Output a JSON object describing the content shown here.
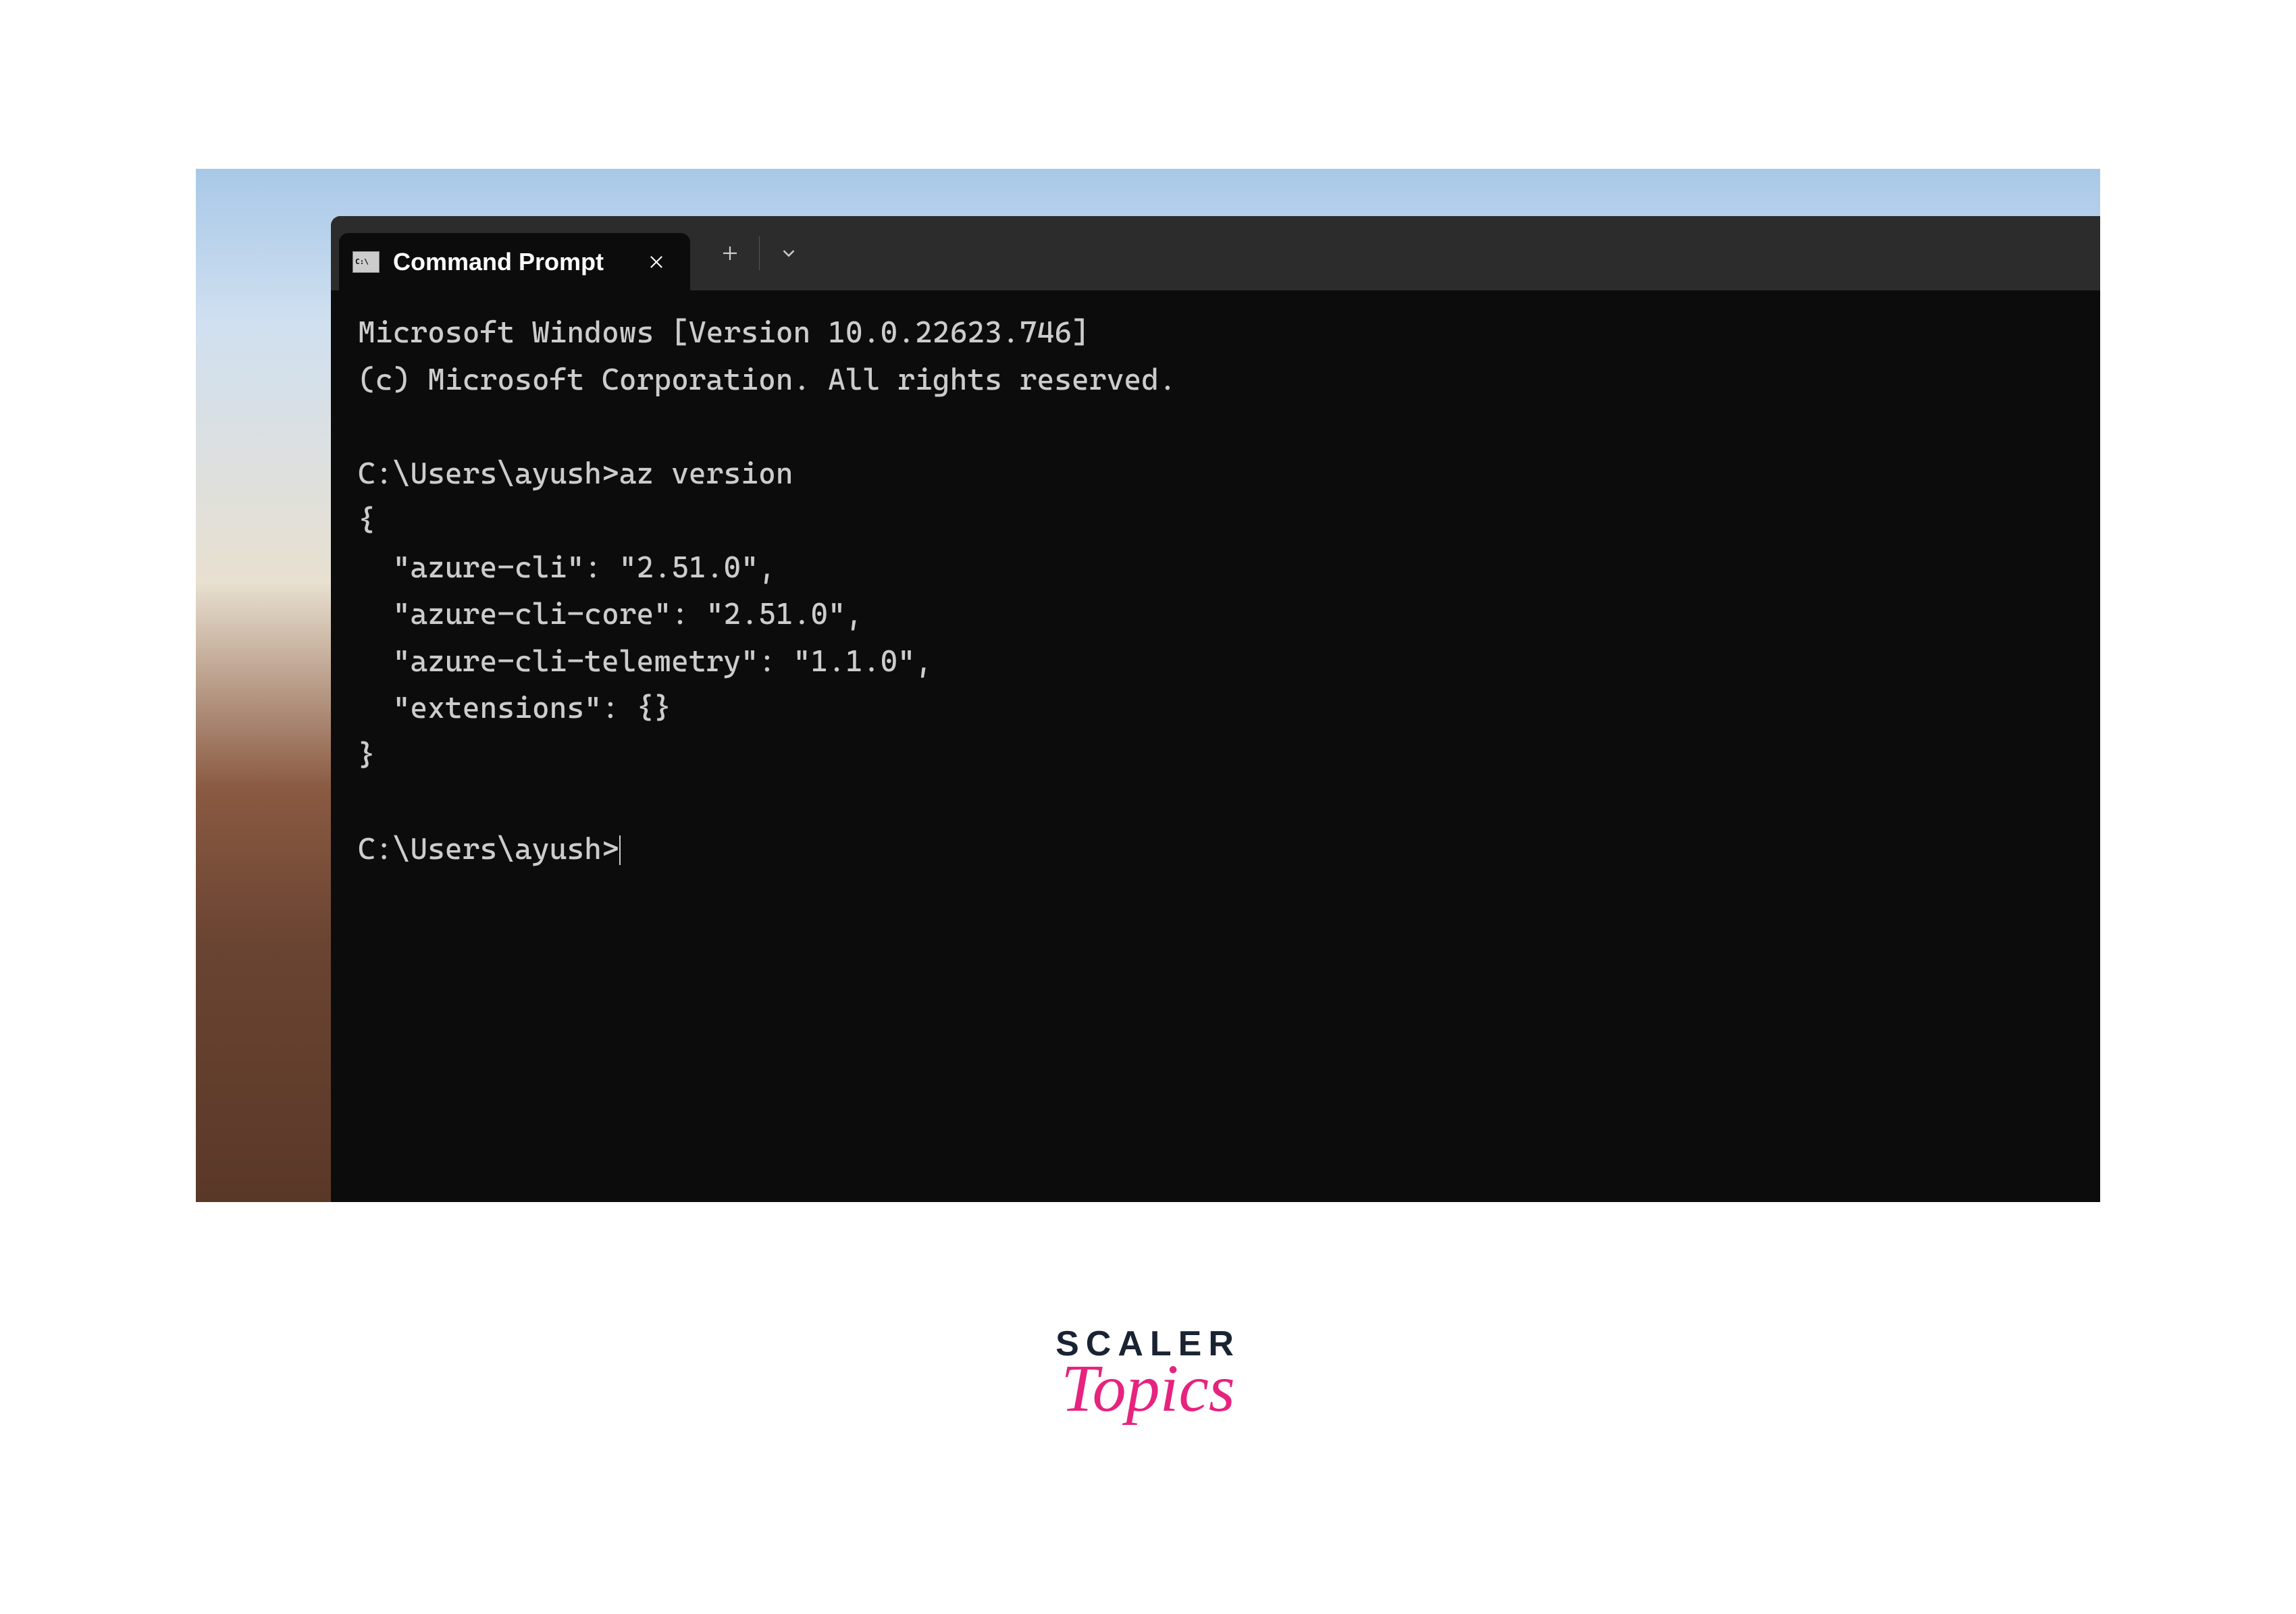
{
  "tab": {
    "title": "Command Prompt"
  },
  "terminal": {
    "banner_line1": "Microsoft Windows [Version 10.0.22623.746]",
    "banner_line2": "(c) Microsoft Corporation. All rights reserved.",
    "prompt1": "C:\\Users\\ayush>",
    "command1": "az version",
    "output1_line1": "{",
    "output1_line2": "  \"azure-cli\": \"2.51.0\",",
    "output1_line3": "  \"azure-cli-core\": \"2.51.0\",",
    "output1_line4": "  \"azure-cli-telemetry\": \"1.1.0\",",
    "output1_line5": "  \"extensions\": {}",
    "output1_line6": "}",
    "prompt2": "C:\\Users\\ayush>"
  },
  "brand": {
    "line1": "SCALER",
    "line2": "Topics"
  }
}
